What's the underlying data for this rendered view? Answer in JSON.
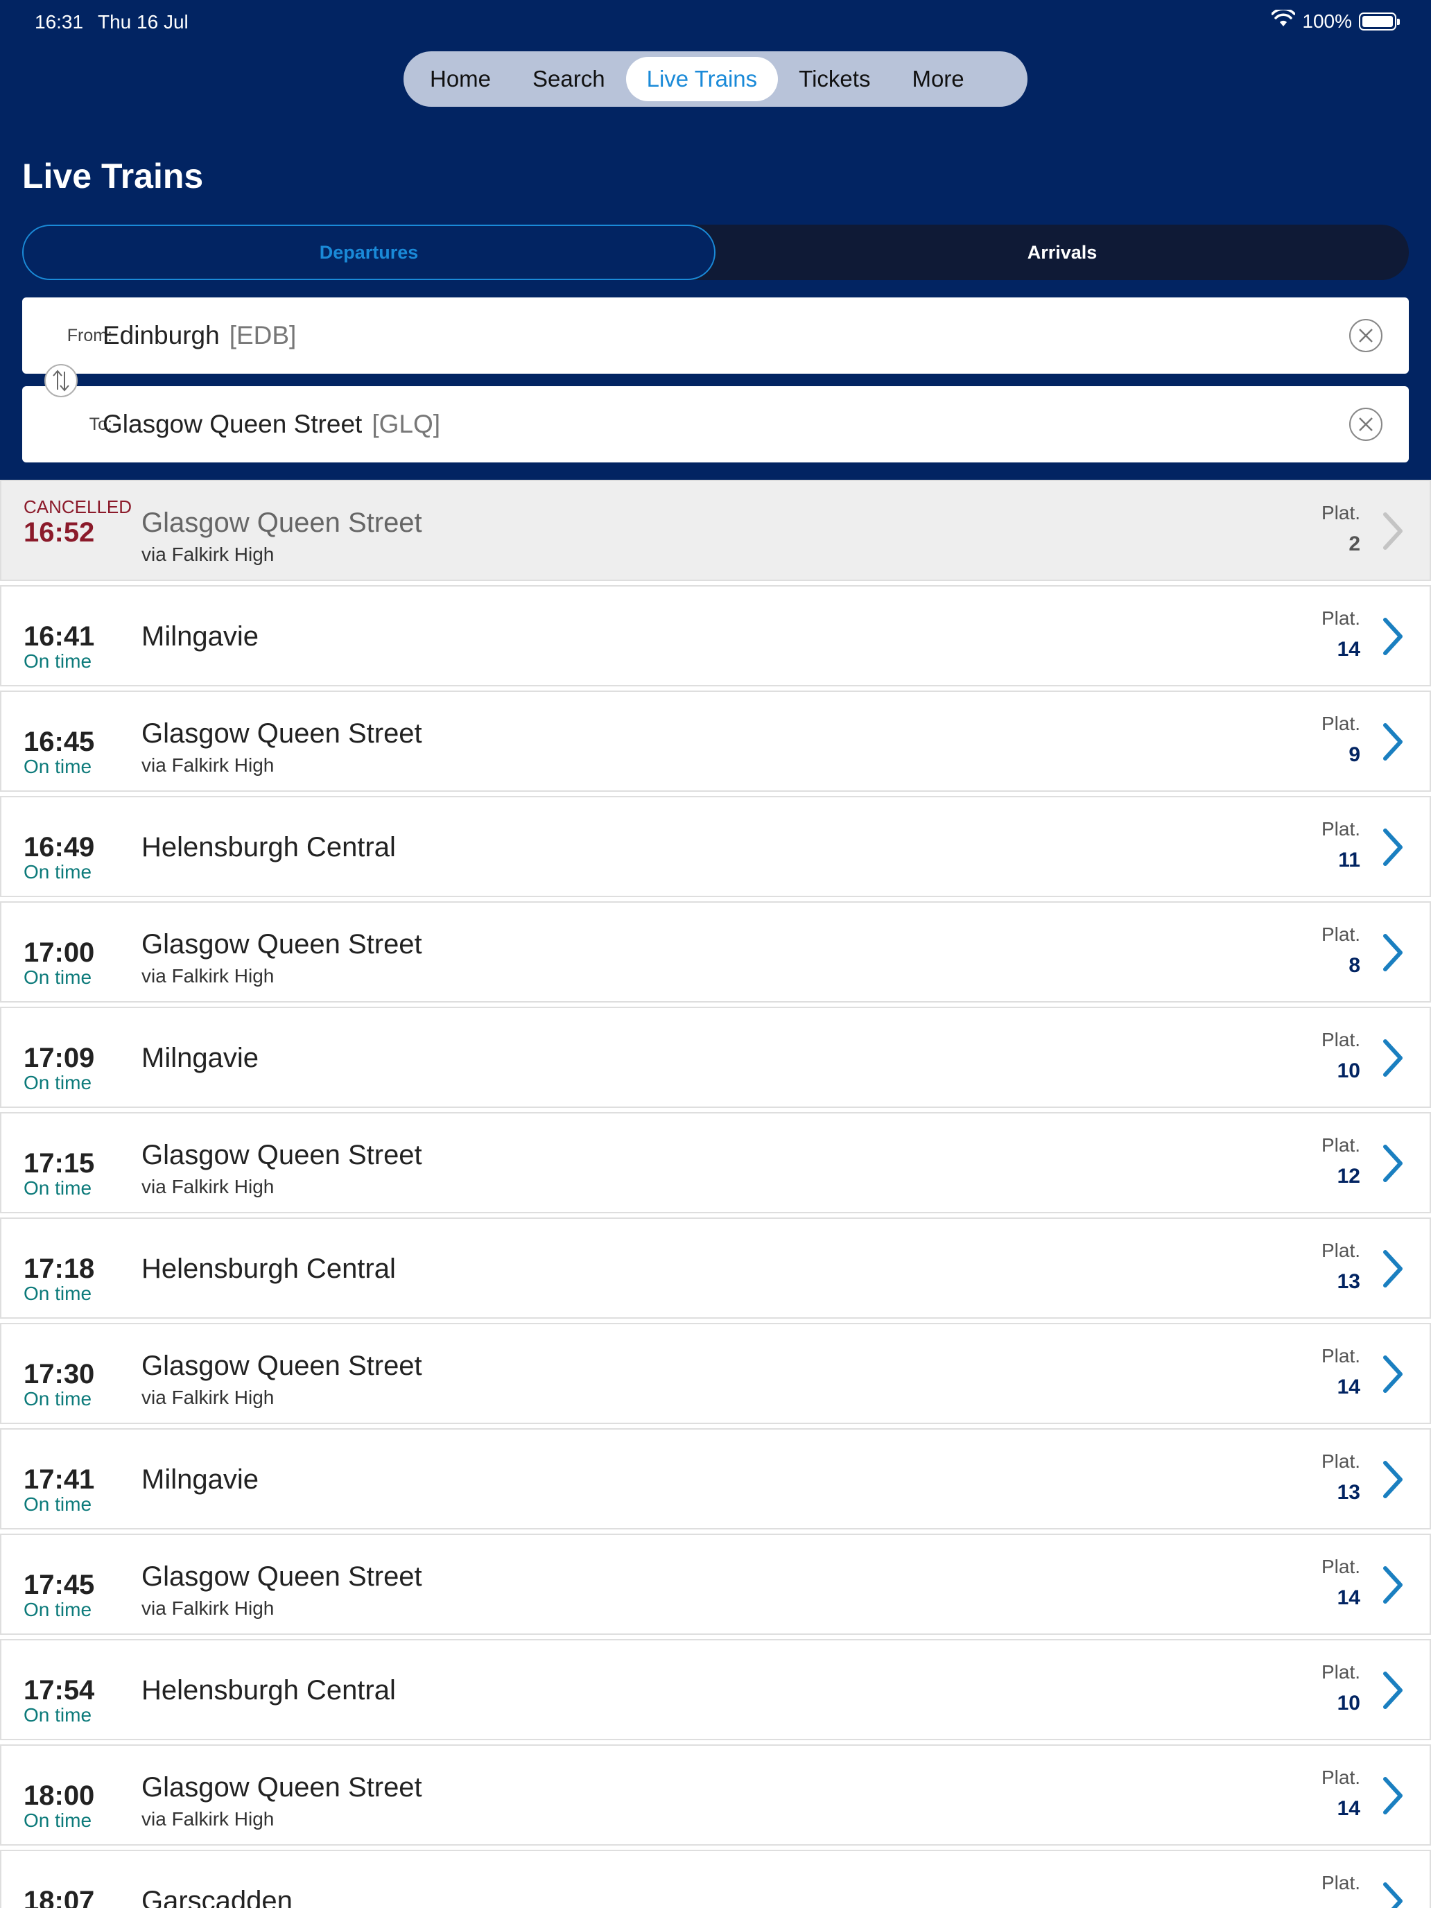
{
  "status_bar": {
    "time": "16:31",
    "date": "Thu 16 Jul",
    "battery": "100%"
  },
  "nav": {
    "tabs": [
      "Home",
      "Search",
      "Live Trains",
      "Tickets",
      "More"
    ],
    "active": "Live Trains"
  },
  "page_title": "Live Trains",
  "segment": {
    "departures": "Departures",
    "arrivals": "Arrivals",
    "selected": "Departures"
  },
  "from": {
    "label": "From:",
    "name": "Edinburgh",
    "code": "[EDB]"
  },
  "to": {
    "label": "To:",
    "name": "Glasgow Queen Street",
    "code": "[GLQ]"
  },
  "plat_label": "Plat.",
  "services": [
    {
      "time": "16:52",
      "status": "CANCELLED",
      "destination": "Glasgow Queen Street",
      "via": "via Falkirk High",
      "platform": "2",
      "cancelled": true
    },
    {
      "time": "16:41",
      "status": "On time",
      "destination": "Milngavie",
      "via": "",
      "platform": "14"
    },
    {
      "time": "16:45",
      "status": "On time",
      "destination": "Glasgow Queen Street",
      "via": "via Falkirk High",
      "platform": "9"
    },
    {
      "time": "16:49",
      "status": "On time",
      "destination": "Helensburgh Central",
      "via": "",
      "platform": "11"
    },
    {
      "time": "17:00",
      "status": "On time",
      "destination": "Glasgow Queen Street",
      "via": "via Falkirk High",
      "platform": "8"
    },
    {
      "time": "17:09",
      "status": "On time",
      "destination": "Milngavie",
      "via": "",
      "platform": "10"
    },
    {
      "time": "17:15",
      "status": "On time",
      "destination": "Glasgow Queen Street",
      "via": "via Falkirk High",
      "platform": "12"
    },
    {
      "time": "17:18",
      "status": "On time",
      "destination": "Helensburgh Central",
      "via": "",
      "platform": "13"
    },
    {
      "time": "17:30",
      "status": "On time",
      "destination": "Glasgow Queen Street",
      "via": "via Falkirk High",
      "platform": "14"
    },
    {
      "time": "17:41",
      "status": "On time",
      "destination": "Milngavie",
      "via": "",
      "platform": "13"
    },
    {
      "time": "17:45",
      "status": "On time",
      "destination": "Glasgow Queen Street",
      "via": "via Falkirk High",
      "platform": "14"
    },
    {
      "time": "17:54",
      "status": "On time",
      "destination": "Helensburgh Central",
      "via": "",
      "platform": "10"
    },
    {
      "time": "18:00",
      "status": "On time",
      "destination": "Glasgow Queen Street",
      "via": "via Falkirk High",
      "platform": "14"
    },
    {
      "time": "18:07",
      "status": "",
      "destination": "Garscadden",
      "via": "",
      "platform": ""
    }
  ],
  "colors": {
    "header_bg": "#022462",
    "accent": "#1a8ad8",
    "on_time": "#0c7a7a",
    "cancelled": "#8b1a2a",
    "chevron": "#1a7fc0"
  }
}
